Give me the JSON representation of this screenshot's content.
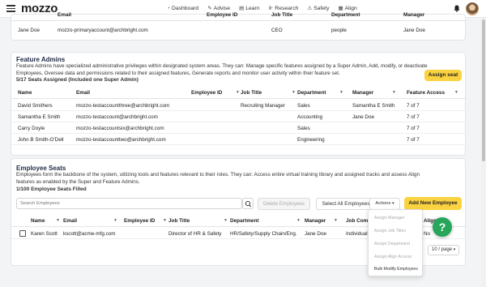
{
  "nav": {
    "logo": "mozzo",
    "links": [
      {
        "label": "Dashboard",
        "icon": "gauge-icon"
      },
      {
        "label": "Advise",
        "icon": "wrench-icon"
      },
      {
        "label": "Learn",
        "icon": "book-icon"
      },
      {
        "label": "Research",
        "icon": "chart-icon"
      },
      {
        "label": "Safety",
        "icon": "safety-icon"
      },
      {
        "label": "Align",
        "icon": "align-icon"
      }
    ]
  },
  "super_admin": {
    "headers": [
      "Name",
      "Email",
      "Employee ID",
      "Job Title",
      "Department",
      "Manager"
    ],
    "row": {
      "name": "Jane Doe",
      "email": "mozzo-primaryaccount@archbright.com",
      "employee_id": "",
      "job_title": "CEO",
      "department": "people",
      "manager": "Jane Doe"
    }
  },
  "feature_admins": {
    "title": "Feature Admins",
    "description": "Feature Admins have specialized administrative privileges within designated system areas. They can: Manage specific features assigned by a Super Admin, Add, modify, or deactivate Employees, Oversee data and permissions related to their assigned features, Generate reports and monitor user activity within their feature set.",
    "seats": "5/17 Seats Assigned (Included one Super Admin)",
    "assign_button": "Assign seat",
    "headers": [
      "Name",
      "Email",
      "Employee ID",
      "Job Title",
      "Department",
      "Manager",
      "Feature Access"
    ],
    "rows": [
      {
        "name": "David Smithers",
        "email": "mozzo-testaccountthree@archbright.com",
        "employee_id": "",
        "job_title": "Recruiting Manager",
        "department": "Sales",
        "manager": "Samantha E Smith",
        "access": "7 of 7"
      },
      {
        "name": "Samantha E Smith",
        "email": "mozzo-testaccount@archbright.com",
        "employee_id": "",
        "job_title": "",
        "department": "Accounting",
        "manager": "Jane Doe",
        "access": "7 of 7"
      },
      {
        "name": "Carry Doyle",
        "email": "mozzo-testaccountsix@archbright.com",
        "employee_id": "",
        "job_title": "",
        "department": "Sales",
        "manager": "",
        "access": "7 of 7"
      },
      {
        "name": "John B Smith-O'Dell",
        "email": "mozzo-testaccounttwo@archbright.com",
        "employee_id": "",
        "job_title": "",
        "department": "Engineering",
        "manager": "",
        "access": "7 of 7"
      }
    ]
  },
  "employee_seats": {
    "title": "Employee Seats",
    "description": "Employees form the backbone of the system, utilizing tools and features relevant to their roles. They can: Access entire virtual training library and assigned tracks and assess Align features as enabled by the Super and Feature Admins.",
    "seats": "1/100 Employee Seats Filled",
    "search_placeholder": "Search Employees",
    "delete_button": "Delete Employees",
    "select_all_button": "Select All Employees",
    "actions_button": "Actions",
    "add_button": "Add New Employee",
    "headers": [
      "Name",
      "Email",
      "Employee ID",
      "Job Title",
      "Department",
      "Manager",
      "Job Comp",
      "Align A"
    ],
    "rows": [
      {
        "name": "Karen Scott",
        "email": "kscott@acme-mfg.com",
        "employee_id": "",
        "job_title": "Director of HR & Safety",
        "department": "HR/Safety/Supply Chain/Eng.",
        "manager": "Jane Doe",
        "job_comp": "Individual",
        "align": "No"
      }
    ],
    "actions_menu": [
      "Assign Manager",
      "Assign Job Titles",
      "Assign Department",
      "Assign Align Access",
      "Bulk Modify Employees"
    ],
    "pager": "10 / page"
  },
  "colors": {
    "accent": "#fbd341",
    "help": "#25a65a",
    "title": "#1f2a44"
  }
}
